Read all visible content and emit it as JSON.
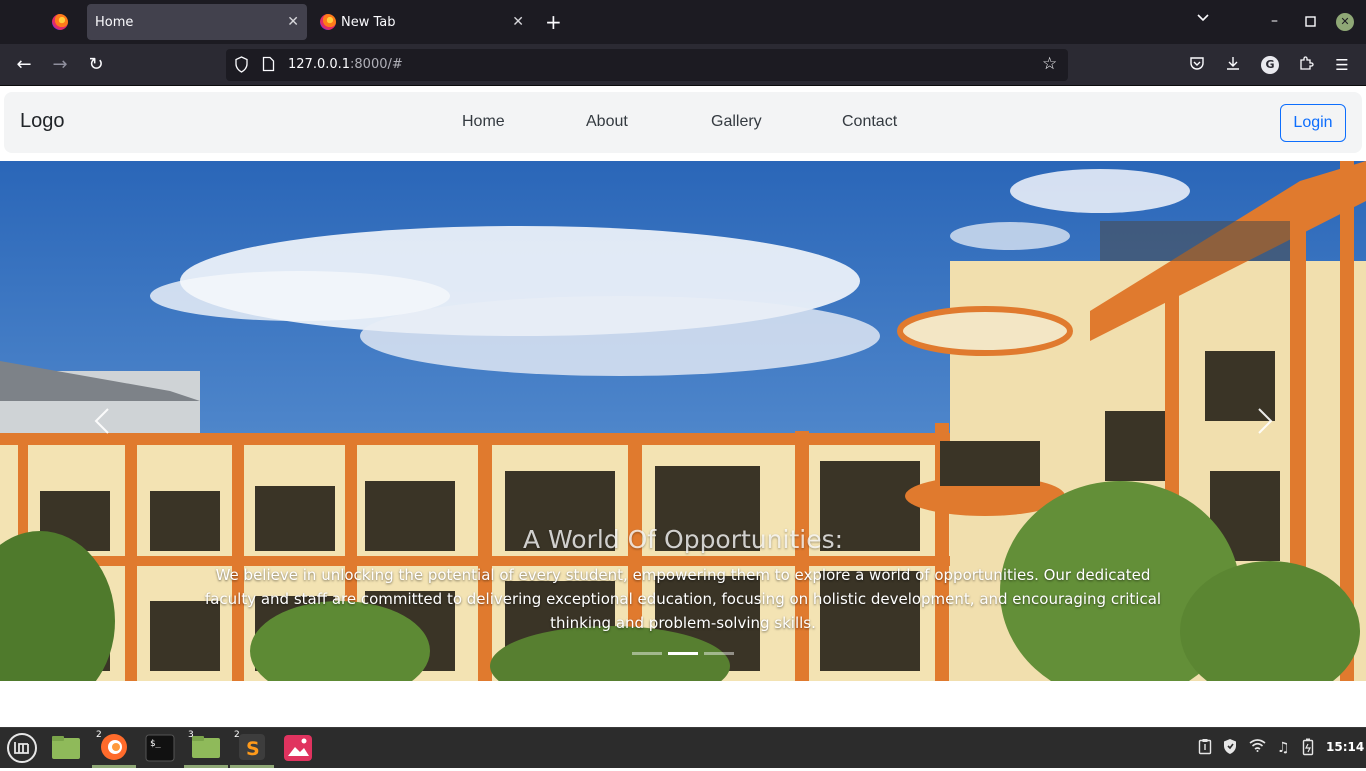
{
  "browser": {
    "tabs": [
      {
        "label": "Home",
        "active": true
      },
      {
        "label": "New Tab",
        "active": false
      }
    ],
    "url_host": "127.0.0.1",
    "url_rest": ":8000/#",
    "icons": [
      "firefox-icon",
      "close-icon",
      "plus-icon",
      "chevron-down-icon",
      "minimize-icon",
      "maximize-icon",
      "window-close-icon",
      "back-arrow-icon",
      "forward-arrow-icon",
      "reload-icon",
      "shield-icon",
      "page-icon",
      "bookmark-star-icon",
      "pocket-icon",
      "download-icon",
      "account-avatar",
      "extensions-icon",
      "hamburger-menu-icon"
    ],
    "avatar_letter": "G"
  },
  "site": {
    "brand": "Logo",
    "menu": [
      "Home",
      "About",
      "Gallery",
      "Contact"
    ],
    "login_label": "Login",
    "login_color": "#0d6efd",
    "nav_bg": "#f3f4f5"
  },
  "carousel": {
    "title": "A World Of Opportunities:",
    "text": "We believe in unlocking the potential of every student, empowering them to explore a world of opportunities. Our dedicated faculty and staff are committed to delivering exceptional education, focusing on holistic development, and encouraging critical thinking and problem-solving skills.",
    "slide_count": 3,
    "active_slide": 2,
    "colors": {
      "sky": "#2f6fc1",
      "building": "#f3e3b3",
      "trim": "#e07a2e"
    }
  },
  "taskbar": {
    "apps": [
      {
        "name": "mint-menu-icon",
        "badge": ""
      },
      {
        "name": "folder-icon",
        "badge": ""
      },
      {
        "name": "firefox-icon",
        "badge": "2"
      },
      {
        "name": "terminal-icon",
        "badge": ""
      },
      {
        "name": "files-icon",
        "badge": "3"
      },
      {
        "name": "sublime-text-icon",
        "badge": "2"
      },
      {
        "name": "image-viewer-icon",
        "badge": ""
      }
    ],
    "tray_icons": [
      "clipboard-icon",
      "shield-tray-icon",
      "wifi-icon",
      "sound-icon",
      "battery-icon"
    ],
    "time": "15:14"
  }
}
